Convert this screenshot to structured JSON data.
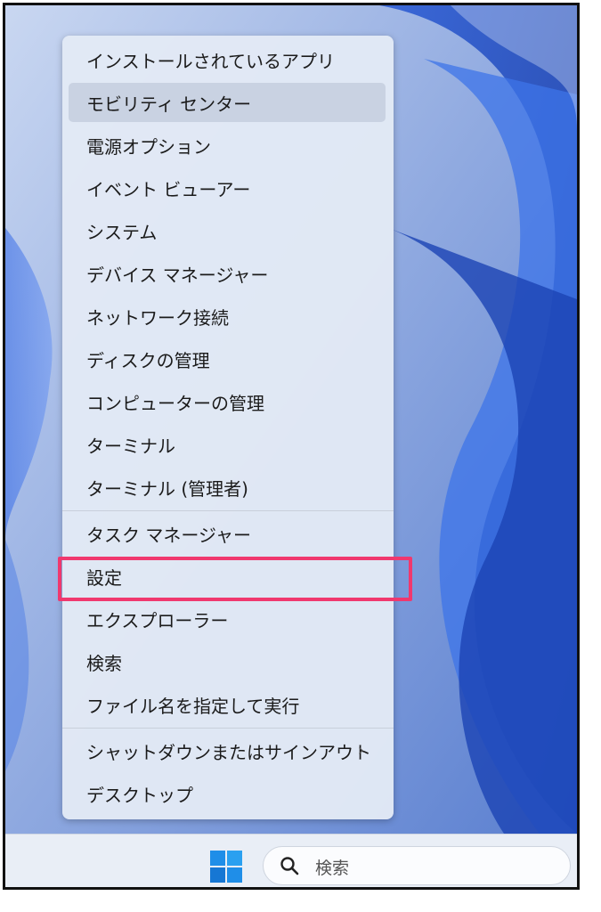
{
  "context_menu": {
    "items": [
      {
        "label": "インストールされているアプリ"
      },
      {
        "label": "モビリティ センター"
      },
      {
        "label": "電源オプション"
      },
      {
        "label": "イベント ビューアー"
      },
      {
        "label": "システム"
      },
      {
        "label": "デバイス マネージャー"
      },
      {
        "label": "ネットワーク接続"
      },
      {
        "label": "ディスクの管理"
      },
      {
        "label": "コンピューターの管理"
      },
      {
        "label": "ターミナル"
      },
      {
        "label": "ターミナル (管理者)"
      },
      {
        "label": "タスク マネージャー"
      },
      {
        "label": "設定"
      },
      {
        "label": "エクスプローラー"
      },
      {
        "label": "検索"
      },
      {
        "label": "ファイル名を指定して実行"
      },
      {
        "label": "シャットダウンまたはサインアウト"
      },
      {
        "label": "デスクトップ"
      }
    ],
    "submenu_indicator": "›"
  },
  "taskbar": {
    "start_icon": "windows-logo-icon",
    "search": {
      "icon": "search-icon",
      "label": "検索"
    }
  },
  "colors": {
    "highlight": "#f0386e",
    "start_blue": "#1f8ee8"
  }
}
